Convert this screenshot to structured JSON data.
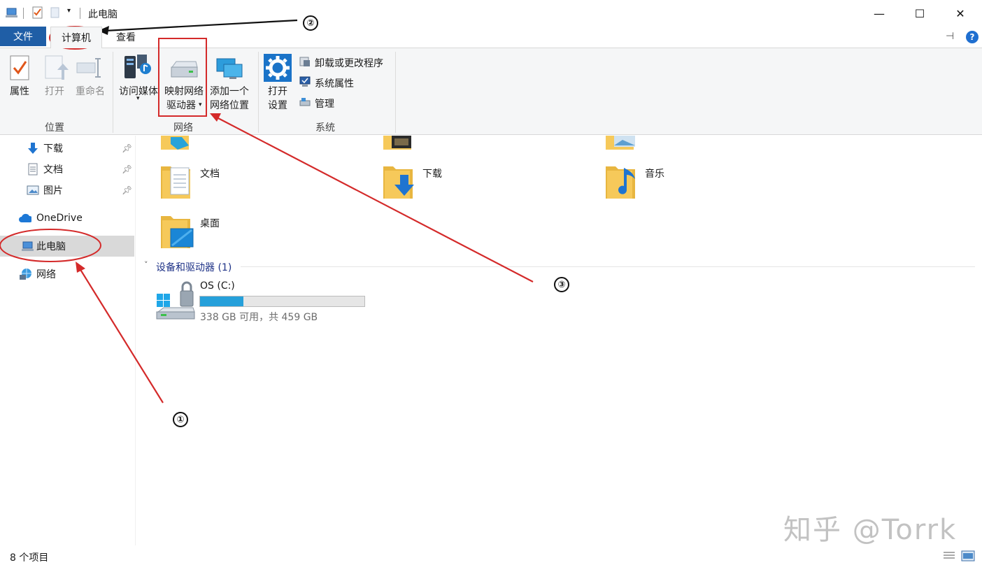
{
  "window": {
    "title": "此电脑",
    "minimize_glyph": "—",
    "maximize_glyph": "☐",
    "close_glyph": "✕"
  },
  "tabs": {
    "file": "文件",
    "computer": "计算机",
    "view": "查看"
  },
  "ribbon": {
    "location": {
      "label": "位置",
      "properties": "属性",
      "open": "打开",
      "rename": "重命名"
    },
    "network": {
      "label": "网络",
      "media_line1": "访问媒体",
      "map_line1": "映射网络",
      "map_line2": "驱动器",
      "add_line1": "添加一个",
      "add_line2": "网络位置"
    },
    "system": {
      "label": "系统",
      "settings_line1": "打开",
      "settings_line2": "设置",
      "uninstall": "卸载或更改程序",
      "sys_props": "系统属性",
      "manage": "管理"
    },
    "help_glyph": "?"
  },
  "nav": {
    "downloads": "下载",
    "documents": "文档",
    "pictures": "图片",
    "onedrive": "OneDrive",
    "this_pc": "此电脑",
    "network": "网络"
  },
  "folders": {
    "documents": "文档",
    "downloads": "下载",
    "music": "音乐",
    "desktop": "桌面"
  },
  "devices": {
    "header": "设备和驱动器 (1)",
    "drive_name": "OS (C:)",
    "drive_info": "338 GB 可用，共 459 GB",
    "used_fraction": 0.264
  },
  "status": {
    "items": "8 个项目"
  },
  "annotations": {
    "n1": "①",
    "n2": "②",
    "n3": "③"
  },
  "watermark": "知乎 @Torrk",
  "colors": {
    "accent": "#1f5ea6",
    "annotation_red": "#d42a2a",
    "drive_fill": "#26a0da",
    "folder_yellow": "#f6c95a"
  }
}
